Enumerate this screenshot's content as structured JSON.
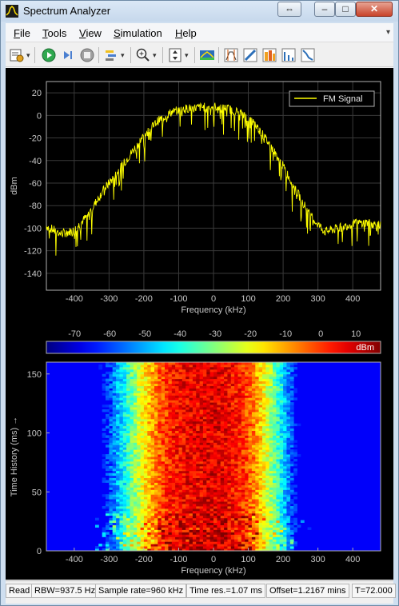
{
  "window": {
    "title": "Spectrum Analyzer",
    "controls": {
      "restore": "⇔",
      "minimize": "–",
      "maximize": "□",
      "close": "✕"
    }
  },
  "menu": {
    "items": [
      {
        "accel": "F",
        "rest": "ile"
      },
      {
        "accel": "T",
        "rest": "ools"
      },
      {
        "accel": "V",
        "rest": "iew"
      },
      {
        "accel": "S",
        "rest": "imulation"
      },
      {
        "accel": "H",
        "rest": "elp"
      }
    ],
    "overflow_icon": "chevron-down-icon"
  },
  "toolbar": {
    "icons": [
      "settings-icon",
      "play-icon",
      "step-forward-icon",
      "stop-icon",
      "highlight-icon",
      "zoom-icon",
      "scale-axes-icon",
      "spectrum-icon",
      "cursor-measure-icon",
      "peak-finder-icon",
      "channel-measure-icon",
      "distortion-icon",
      "ccdf-icon"
    ]
  },
  "theme": {
    "background": "#000000",
    "axes_color": "#b0b0b0",
    "trace_color": "#ffff00",
    "text_color": "#c8c8c8"
  },
  "chart_data": [
    {
      "type": "line",
      "title": "",
      "xlabel": "Frequency (kHz)",
      "ylabel": "dBm",
      "xlim": [
        -480,
        480
      ],
      "ylim": [
        -155,
        30
      ],
      "x_ticks": [
        -400,
        -300,
        -200,
        -100,
        0,
        100,
        200,
        300,
        400
      ],
      "y_ticks": [
        20,
        0,
        -20,
        -40,
        -60,
        -80,
        -100,
        -120,
        -140
      ],
      "grid": true,
      "legend": "top-right",
      "series": [
        {
          "name": "FM Signal",
          "color": "#ffff00",
          "x": [
            -480,
            -440,
            -400,
            -360,
            -320,
            -280,
            -240,
            -200,
            -160,
            -120,
            -80,
            -40,
            0,
            40,
            80,
            120,
            160,
            200,
            240,
            280,
            320,
            360,
            400,
            440,
            480
          ],
          "values": [
            -98,
            -105,
            -102,
            -88,
            -68,
            -52,
            -35,
            -18,
            -5,
            3,
            6,
            7,
            8,
            6,
            2,
            -8,
            -25,
            -45,
            -68,
            -90,
            -103,
            -100,
            -96,
            -95,
            -98
          ]
        }
      ]
    },
    {
      "type": "heatmap",
      "title": "",
      "xlabel": "Frequency (kHz)",
      "ylabel": "Time History (ms) →",
      "xlim": [
        -480,
        480
      ],
      "ylim": [
        0,
        160
      ],
      "x_ticks": [
        -400,
        -300,
        -200,
        -100,
        0,
        100,
        200,
        300,
        400
      ],
      "y_ticks": [
        0,
        50,
        100,
        150
      ],
      "colorbar": {
        "label": "dBm",
        "ticks": [
          -70,
          -60,
          -50,
          -40,
          -30,
          -20,
          -10,
          0,
          10
        ],
        "range": [
          -78,
          17
        ],
        "position": "top"
      }
    }
  ],
  "status": {
    "state": "Read",
    "rbw": "RBW=937.5 Hz",
    "sample_rate": "Sample rate=960 kHz",
    "time_res": "Time res.=1.07 ms",
    "offset": "Offset=1.2167 mins",
    "time": "T=72.000"
  }
}
